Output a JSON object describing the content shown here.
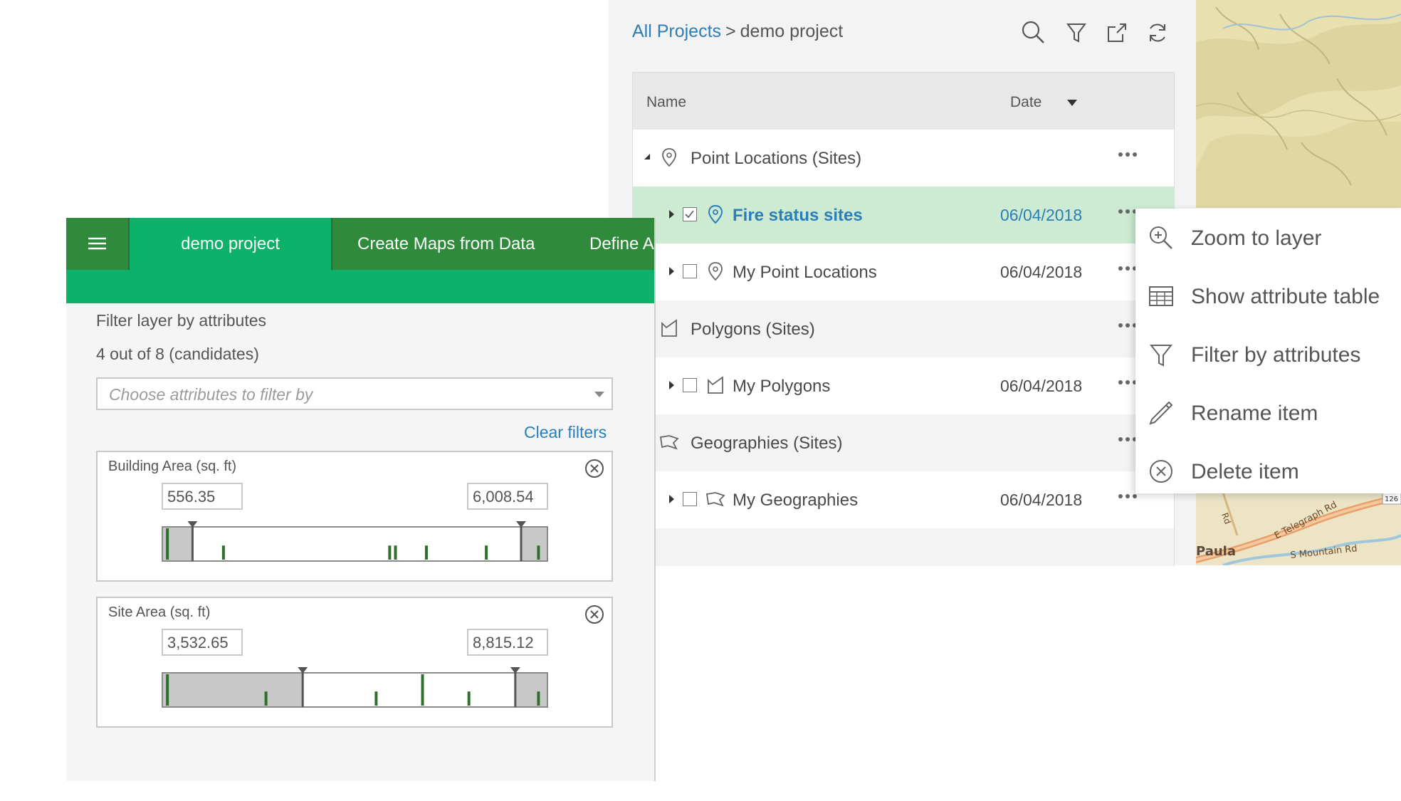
{
  "colors": {
    "tab_bar": "#2f8a3c",
    "tab_active": "#0db16a",
    "link": "#2a7fb8",
    "selected_row": "#cdebd2",
    "histogram_bar": "#2e6f2e",
    "histogram_excluded": "#c8c8c8"
  },
  "app": {
    "tabs": [
      {
        "label": "demo project",
        "active": true
      },
      {
        "label": "Create Maps from Data",
        "active": false
      },
      {
        "label": "Define A",
        "active": false
      }
    ],
    "menu_icon": "hamburger-icon"
  },
  "filter": {
    "title": "Filter layer by attributes",
    "count": "4 out of 8 (candidates)",
    "placeholder": "Choose attributes to filter by",
    "clear_label": "Clear filters",
    "ranges": [
      {
        "title": "Building Area (sq. ft)",
        "min": "556.35",
        "max": "6,008.54",
        "selected_fraction": [
          0.08,
          0.93
        ],
        "bars": [
          0.015,
          0.16,
          0.59,
          0.605,
          0.685,
          0.84,
          0.975
        ],
        "bar_heights": [
          1.0,
          0.45,
          0.45,
          0.45,
          0.45,
          0.45,
          0.45
        ]
      },
      {
        "title": "Site Area (sq. ft)",
        "min": "3,532.65",
        "max": "8,815.12",
        "selected_fraction": [
          0.365,
          0.915
        ],
        "bars": [
          0.015,
          0.27,
          0.555,
          0.675,
          0.795,
          0.975
        ],
        "bar_heights": [
          1.0,
          0.45,
          0.45,
          1.0,
          0.45,
          0.45
        ]
      }
    ]
  },
  "project": {
    "breadcrumb": {
      "root": "All Projects",
      "separator": ">",
      "current": "demo project"
    },
    "toolbar_icons": [
      "search-icon",
      "filter-icon",
      "export-icon",
      "refresh-icon"
    ],
    "columns": {
      "name": "Name",
      "date": "Date"
    },
    "rows": [
      {
        "type": "group",
        "label": "Point Locations (Sites)",
        "icon": "pin-icon",
        "expanded": true
      },
      {
        "type": "layer",
        "label": "Fire status sites",
        "icon": "pin-icon",
        "date": "06/04/2018",
        "checked": true,
        "selected": true
      },
      {
        "type": "layer",
        "label": "My Point Locations",
        "icon": "pin-icon",
        "date": "06/04/2018",
        "checked": false
      },
      {
        "type": "group",
        "label": "Polygons (Sites)",
        "icon": "polygon-icon"
      },
      {
        "type": "layer",
        "label": "My Polygons",
        "icon": "polygon-icon",
        "date": "06/04/2018",
        "checked": false
      },
      {
        "type": "group",
        "label": "Geographies (Sites)",
        "icon": "geography-icon"
      },
      {
        "type": "layer",
        "label": "My Geographies",
        "icon": "geography-icon",
        "date": "06/04/2018",
        "checked": false
      }
    ]
  },
  "context_menu": {
    "items": [
      {
        "label": "Zoom to layer",
        "icon": "zoom-in-icon"
      },
      {
        "label": "Show attribute table",
        "icon": "table-icon"
      },
      {
        "label": "Filter by attributes",
        "icon": "filter-icon"
      },
      {
        "label": "Rename item",
        "icon": "pencil-icon"
      },
      {
        "label": "Delete item",
        "icon": "close-circle-icon"
      }
    ]
  },
  "map": {
    "labels": [
      "E Telegraph Rd",
      "S Mountain Rd",
      "Paula",
      "Rd",
      "126"
    ]
  }
}
